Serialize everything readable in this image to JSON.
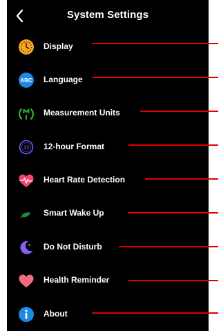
{
  "header": {
    "title": "System Settings",
    "back_icon": "chevron-left-icon"
  },
  "settings": {
    "items": [
      {
        "label": "Display",
        "icon": "sun-clock-icon",
        "icon_color": "#f5a623"
      },
      {
        "label": "Language",
        "icon": "abc-language-icon",
        "icon_color": "#1e88e5"
      },
      {
        "label": "Measurement Units",
        "icon": "measurement-units-icon",
        "icon_color": "#36c42a"
      },
      {
        "label": "12-hour Format",
        "icon": "twelve-hour-icon",
        "icon_color": "#6a5cff"
      },
      {
        "label": "Heart Rate Detection",
        "icon": "heart-rate-icon",
        "icon_color": "#f0466e"
      },
      {
        "label": "Smart Wake Up",
        "icon": "smart-wake-icon",
        "icon_color": "#1f8a3c"
      },
      {
        "label": "Do Not Disturb",
        "icon": "moon-icon",
        "icon_color": "#8b5cf6"
      },
      {
        "label": "Health Reminder",
        "icon": "heart-icon",
        "icon_color": "#f26b7e"
      },
      {
        "label": "About",
        "icon": "info-icon",
        "icon_color": "#1e88e5"
      }
    ]
  },
  "colors": {
    "background": "#000000",
    "text": "#ffffff",
    "annotation_line": "#e00000"
  }
}
